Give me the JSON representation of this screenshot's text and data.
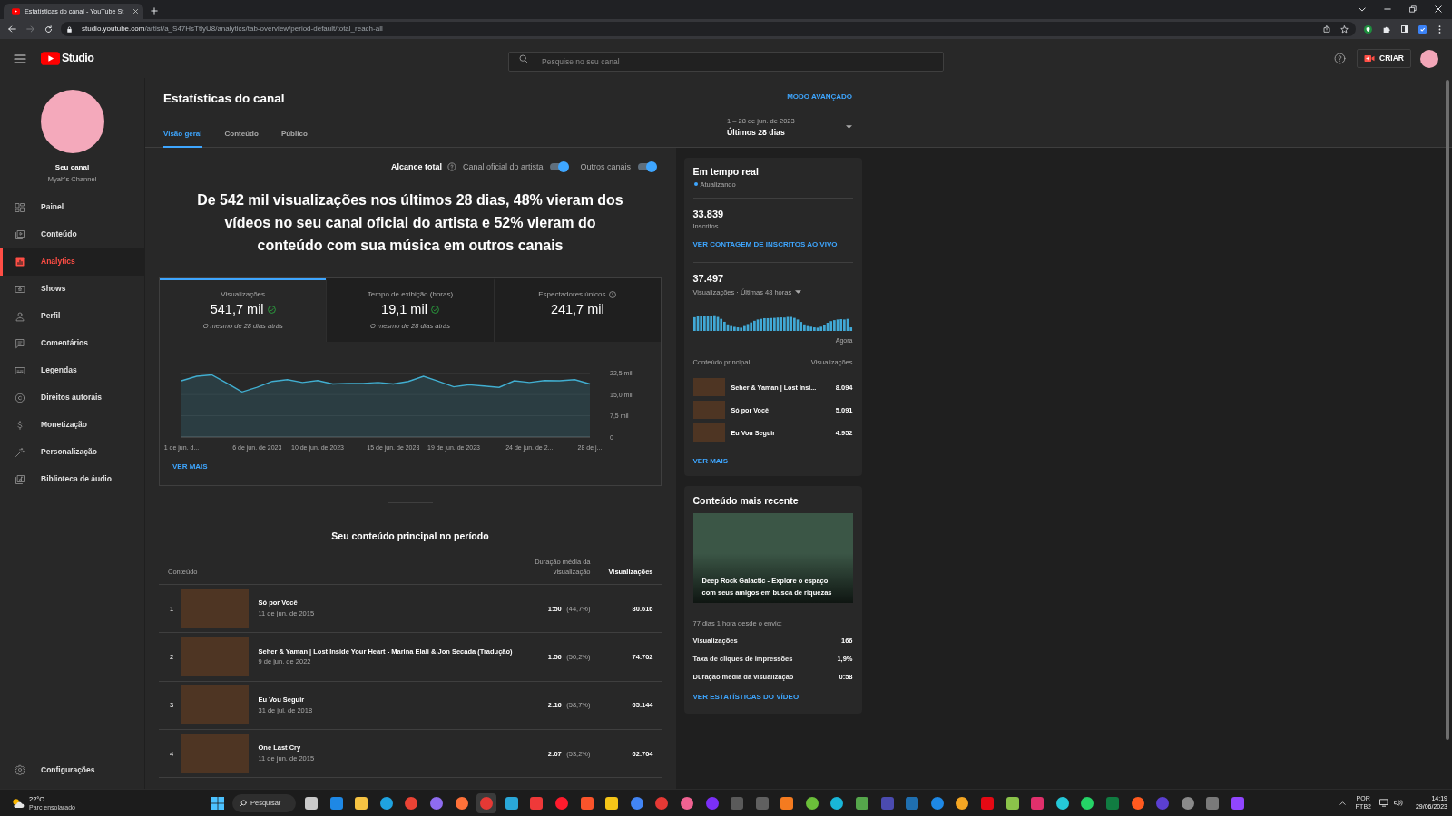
{
  "browser": {
    "tabs": [
      {
        "title": "Estatísticas do canal - YouTube St",
        "selected": true
      }
    ],
    "url": {
      "host": "studio.youtube.com",
      "path": "/artist/a_S47HsTtlyU8/analytics/tab-overview/period-default/total_reach-all"
    }
  },
  "header": {
    "logo": "Studio",
    "search": {
      "placeholder": "Pesquise no seu canal"
    },
    "create_button": "CRIAR"
  },
  "sidebar": {
    "channel": {
      "title": "Seu canal",
      "name": "Myah's Channel"
    },
    "items": [
      {
        "label": "Painel",
        "selected": false
      },
      {
        "label": "Conteúdo",
        "selected": false
      },
      {
        "label": "Analytics",
        "selected": true
      },
      {
        "label": "Shows",
        "selected": false
      },
      {
        "label": "Perfil",
        "selected": false
      },
      {
        "label": "Comentários",
        "selected": false
      },
      {
        "label": "Legendas",
        "selected": false
      },
      {
        "label": "Direitos autorais",
        "selected": false
      },
      {
        "label": "Monetização",
        "selected": false
      },
      {
        "label": "Personalização",
        "selected": false
      },
      {
        "label": "Biblioteca de áudio",
        "selected": false
      }
    ],
    "settings": {
      "label": "Configurações"
    }
  },
  "page": {
    "title": "Estatísticas do canal",
    "tabs": [
      {
        "label": "Visão geral",
        "selected": true
      },
      {
        "label": "Conteúdo",
        "selected": false
      },
      {
        "label": "Público",
        "selected": false
      }
    ],
    "advanced_mode": "MODO AVANÇADO",
    "date_range": {
      "dates": "1 – 28 de jun. de 2023",
      "period": "Últimos 28 dias"
    }
  },
  "reach": {
    "label": "Alcance total",
    "toggles": [
      {
        "label": "Canal oficial do artista",
        "on": true
      },
      {
        "label": "Outros canais",
        "on": true
      }
    ],
    "headline": "De 542 mil visualizações nos últimos 28 dias, 48% vieram dos\nvídeos no seu canal oficial do artista e 52% vieram do\nconteúdo com sua música em outros canais"
  },
  "metrics": {
    "tabs": [
      {
        "kind": "compared",
        "label": "Visualizações",
        "value": "541,7 mil",
        "comparison": "O mesmo de 28 dias atrás",
        "selected": true
      },
      {
        "kind": "compared",
        "label": "Tempo de exibição (horas)",
        "value": "19,1 mil",
        "comparison": "O mesmo de 28 dias atrás",
        "selected": false
      },
      {
        "kind": "delayed",
        "label": "Espectadores únicos",
        "value": "241,7 mil",
        "selected": false
      }
    ],
    "chart_data": {
      "type": "area",
      "categories": [
        "1 de jun. d...",
        null,
        null,
        null,
        null,
        "6 de jun. de 2023",
        null,
        null,
        null,
        "10 de jun. de 2023",
        null,
        null,
        null,
        null,
        "15 de jun. de 2023",
        null,
        null,
        null,
        "19 de jun. de 2023",
        null,
        null,
        null,
        null,
        "24 de jun. de 2...",
        null,
        null,
        null,
        "28 de j..."
      ],
      "series": [
        {
          "color": "#41aed0",
          "values": [
            19.8,
            21.4,
            21.9,
            19.0,
            15.9,
            17.5,
            19.6,
            20.2,
            19.2,
            19.9,
            18.7,
            18.9,
            18.9,
            19.2,
            18.7,
            19.6,
            21.4,
            19.6,
            17.7,
            18.4,
            18.0,
            17.5,
            19.8,
            19.2,
            19.9,
            19.8,
            20.2,
            18.7
          ]
        }
      ],
      "ylim": [
        0,
        22.5
      ],
      "yticks": [
        {
          "value": 0,
          "label": "0"
        },
        {
          "value": 7.5,
          "label": "7,5 mil"
        },
        {
          "value": 15,
          "label": "15,0 mil"
        },
        {
          "value": 22.5,
          "label": "22,5 mil"
        }
      ]
    },
    "more_link": "VER MAIS"
  },
  "top_content": {
    "title": "Seu conteúdo principal no período",
    "columns": [
      {
        "label": "Conteúdo",
        "sorted": false
      },
      {
        "label": "Duração média da visualização",
        "sorted": false
      },
      {
        "label": "Visualizações",
        "sorted": true
      }
    ],
    "rows": [
      {
        "rank": "1",
        "title": "Só por Você",
        "date": "11 de jun. de 2015",
        "duration": "1:50",
        "share": "(44,7%)",
        "views": "80.616"
      },
      {
        "rank": "2",
        "title": "Seher & Yaman | Lost Inside Your Heart - Marina Elali & Jon Secada (Tradução)",
        "date": "9 de jun. de 2022",
        "duration": "1:56",
        "share": "(50,2%)",
        "views": "74.702"
      },
      {
        "rank": "3",
        "title": "Eu Vou Seguir",
        "date": "31 de jul. de 2018",
        "duration": "2:16",
        "share": "(58,7%)",
        "views": "65.144"
      },
      {
        "rank": "4",
        "title": "One Last Cry",
        "date": "11 de jun. de 2015",
        "duration": "2:07",
        "share": "(53,2%)",
        "views": "62.704"
      }
    ]
  },
  "realtime": {
    "title": "Em tempo real",
    "status": "Atualizando",
    "subscribers": {
      "value": "33.839",
      "label": "Inscritos",
      "link": "VER CONTAGEM DE INSCRITOS AO VIVO"
    },
    "views": {
      "value": "37.497",
      "label": "Visualizações · Últimas 48 horas",
      "axis_label": "Agora"
    },
    "top_content": {
      "columns": [
        "Conteúdo principal",
        "Visualizações"
      ],
      "rows": [
        {
          "title": "Seher & Yaman | Lost Insi...",
          "views": "8.094"
        },
        {
          "title": "Só por Você",
          "views": "5.091"
        },
        {
          "title": "Eu Vou Seguir",
          "views": "4.952"
        }
      ]
    },
    "more_link": "VER MAIS"
  },
  "latest": {
    "title": "Conteúdo mais recente",
    "video_title": "Deep Rock Galactic - Explore o espaço com seus amigos em busca de riquezas",
    "age": "77 dias 1 hora desde o envio:",
    "stats": [
      {
        "label": "Visualizações",
        "value": "166"
      },
      {
        "label": "Taxa de cliques de impressões",
        "value": "1,9%"
      },
      {
        "label": "Duração média da visualização",
        "value": "0:58"
      }
    ],
    "link": "VER ESTATÍSTICAS DO VÍDEO"
  },
  "taskbar": {
    "weather": {
      "temperature": "22°C",
      "condition": "Parc ensolarado"
    },
    "search": "Pesquisar",
    "apps": [
      {
        "selected": false
      },
      {
        "selected": false
      },
      {
        "selected": false
      },
      {
        "selected": false
      },
      {
        "selected": false
      },
      {
        "selected": false
      },
      {
        "selected": false
      },
      {
        "selected": true
      },
      {
        "selected": false
      },
      {
        "selected": false
      },
      {
        "selected": false
      },
      {
        "selected": false
      },
      {
        "selected": false
      },
      {
        "selected": false
      },
      {
        "selected": false
      },
      {
        "selected": false
      },
      {
        "selected": false
      },
      {
        "selected": false
      },
      {
        "selected": false
      },
      {
        "selected": false
      },
      {
        "selected": false
      },
      {
        "selected": false
      },
      {
        "selected": false
      },
      {
        "selected": false
      },
      {
        "selected": false
      },
      {
        "selected": false
      },
      {
        "selected": false
      },
      {
        "selected": false
      },
      {
        "selected": false
      },
      {
        "selected": false
      },
      {
        "selected": false
      },
      {
        "selected": false
      },
      {
        "selected": false
      },
      {
        "selected": false
      },
      {
        "selected": false
      },
      {
        "selected": false
      },
      {
        "selected": false
      },
      {
        "selected": false
      }
    ],
    "language": {
      "code": "POR",
      "layout": "PTB2"
    },
    "clock": {
      "time": "14:19",
      "date": "29/06/2023"
    }
  }
}
